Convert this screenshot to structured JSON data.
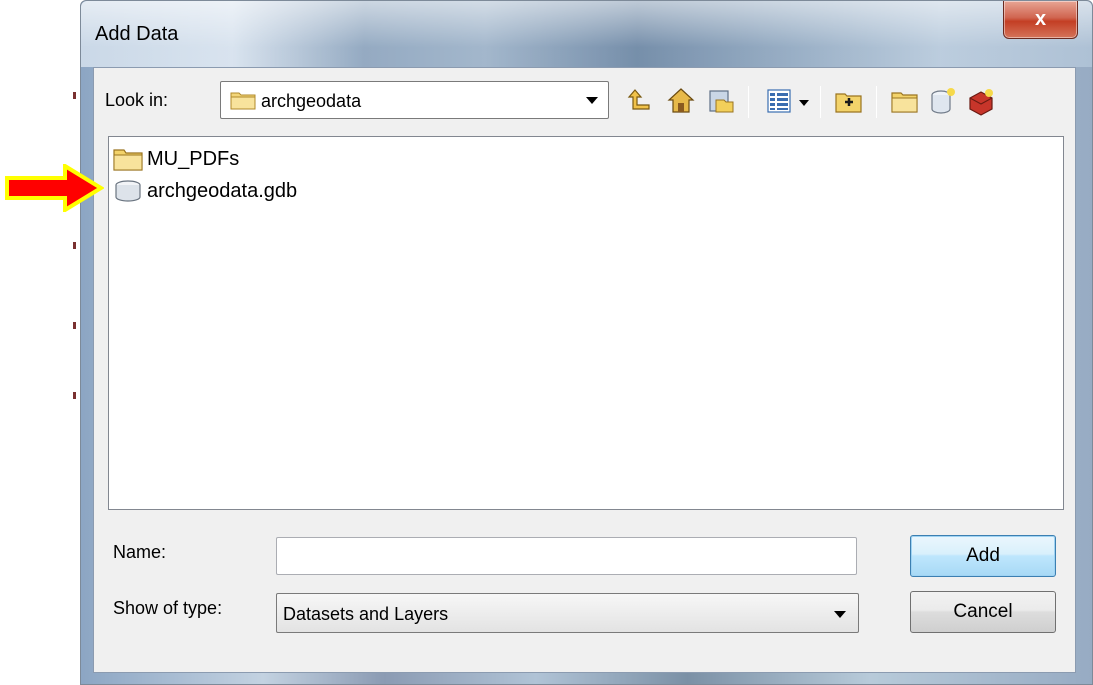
{
  "window": {
    "title": "Add Data",
    "close_label": "x"
  },
  "lookin": {
    "label": "Look in:",
    "value": "archgeodata"
  },
  "toolbar": {
    "icons": [
      "up-one-level-icon",
      "home-icon",
      "connect-to-folder-icon",
      "view-list-icon",
      "view-dropdown-icon",
      "catalog-icon",
      "new-folder-icon",
      "new-file-geodatabase-icon",
      "new-toolbox-icon"
    ]
  },
  "files": [
    {
      "name": "MU_PDFs",
      "icon": "folder-icon"
    },
    {
      "name": "archgeodata.gdb",
      "icon": "geodatabase-icon"
    }
  ],
  "name_field": {
    "label": "Name:",
    "value": ""
  },
  "type_field": {
    "label": "Show of type:",
    "value": "Datasets and Layers"
  },
  "buttons": {
    "add": "Add",
    "cancel": "Cancel"
  },
  "colors": {
    "annotation_arrow": "#ff0000",
    "annotation_outline": "#ffff00"
  }
}
